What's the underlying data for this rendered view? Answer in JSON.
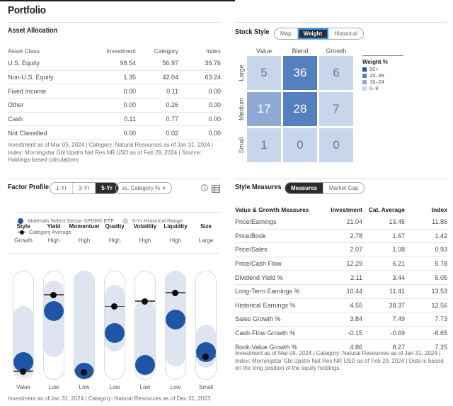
{
  "page": {
    "title": "Portfolio"
  },
  "asset_allocation": {
    "title": "Asset Allocation",
    "columns": [
      "Asset Class",
      "Investment",
      "Category",
      "Index"
    ],
    "rows": [
      [
        "U.S. Equity",
        "98.54",
        "56.97",
        "36.76"
      ],
      [
        "Non-U.S. Equity",
        "1.35",
        "42.04",
        "63.24"
      ],
      [
        "Fixed Income",
        "0.00",
        "0.11",
        "0.00"
      ],
      [
        "Other",
        "0.00",
        "0.26",
        "0.00"
      ],
      [
        "Cash",
        "0.11",
        "0.77",
        "0.00"
      ],
      [
        "Not Classified",
        "0.00",
        "0.02",
        "0.00"
      ]
    ],
    "footnote": "Investment as of Mar 05, 2024 | Category: Natural Resources as of Jan 31, 2024 | Index: Morningstar Gbl Upstm Nat Res NR USD as of Feb 29, 2024 | Source: Holdings-based calculations."
  },
  "stock_style": {
    "title": "Stock Style",
    "tabs": [
      {
        "label": "Map",
        "active": false
      },
      {
        "label": "Weight",
        "active": true
      },
      {
        "label": "Historical",
        "active": false
      }
    ],
    "columns": [
      "Value",
      "Blend",
      "Growth"
    ],
    "rows": [
      "Large",
      "Medium",
      "Small"
    ],
    "cells": [
      [
        5,
        36,
        6
      ],
      [
        17,
        28,
        7
      ],
      [
        1,
        0,
        0
      ]
    ],
    "legend": {
      "title": "Weight %",
      "items": [
        {
          "label": "50+",
          "color": "#1f55a5"
        },
        {
          "label": "25–49",
          "color": "#5580bf"
        },
        {
          "label": "10–24",
          "color": "#8fa9d4"
        },
        {
          "label": "0–9",
          "color": "#c8d6ea"
        }
      ]
    }
  },
  "factor_profile": {
    "title": "Factor Profile",
    "period_tabs": [
      {
        "label": "1-Yr",
        "active": false
      },
      {
        "label": "3-Yr",
        "active": false
      },
      {
        "label": "5-Yr",
        "active": true
      }
    ],
    "compare_dropdown": "vs. Category % ∨",
    "icons": [
      "info-icon",
      "table-icon"
    ],
    "legend": {
      "fund": "Materials Select Sector SPDR® ETF",
      "range": "5-Yr Historical Range",
      "category": "Category Average"
    },
    "colors": {
      "fund": "#1f55a5",
      "range": "#dfe5f0",
      "category": "#0a0a0a"
    },
    "factors": [
      {
        "name": "Style",
        "top": "Growth",
        "bottom": "Value",
        "fund_pct": 15,
        "cat_pct": 6,
        "range_pct": [
          4,
          62
        ]
      },
      {
        "name": "Yield",
        "top": "High",
        "bottom": "Low",
        "fund_pct": 63,
        "cat_pct": 78,
        "range_pct": [
          25,
          86
        ]
      },
      {
        "name": "Momentum",
        "top": "High",
        "bottom": "Low",
        "fund_pct": 5,
        "cat_pct": 5,
        "range_pct": [
          0,
          96
        ]
      },
      {
        "name": "Quality",
        "top": "High",
        "bottom": "Low",
        "fund_pct": 42,
        "cat_pct": 67,
        "range_pct": [
          30,
          82
        ]
      },
      {
        "name": "Volatility",
        "top": "High",
        "bottom": "Low",
        "fund_pct": 12,
        "cat_pct": 72,
        "range_pct": [
          7,
          69
        ]
      },
      {
        "name": "Liquidity",
        "top": "High",
        "bottom": "Low",
        "fund_pct": 55,
        "cat_pct": 80,
        "range_pct": [
          16,
          95
        ]
      },
      {
        "name": "Size",
        "top": "Large",
        "bottom": "Small",
        "fund_pct": 24,
        "cat_pct": 20,
        "range_pct": [
          15,
          45
        ]
      }
    ],
    "footnote": "Investment as of Jan 31, 2024 | Category: Natural Resources as of Dec 31, 2023"
  },
  "style_measures": {
    "title": "Style Measures",
    "tabs": [
      {
        "label": "Measures",
        "active": true
      },
      {
        "label": "Market Cap",
        "active": false
      }
    ],
    "columns": [
      "Value & Growth Measures",
      "Investment",
      "Cat. Average",
      "Index"
    ],
    "rows": [
      [
        "Price/Earnings",
        "21.04",
        "13.45",
        "11.85"
      ],
      [
        "Price/Book",
        "2.78",
        "1.67",
        "1.42"
      ],
      [
        "Price/Sales",
        "2.07",
        "1.08",
        "0.93"
      ],
      [
        "Price/Cash Flow",
        "12.29",
        "6.21",
        "5.78"
      ],
      [
        "Dividend Yield %",
        "2.11",
        "3.44",
        "5.05"
      ],
      [
        "Long-Term Earnings %",
        "10.44",
        "11.41",
        "13.53"
      ],
      [
        "Historical Earnings %",
        "4.55",
        "38.37",
        "12.56"
      ],
      [
        "Sales Growth %",
        "3.84",
        "7.49",
        "7.73"
      ],
      [
        "Cash-Flow Growth %",
        "-0.15",
        "-0.69",
        "-8.65"
      ],
      [
        "Book-Value Growth %",
        "4.86",
        "8.27",
        "7.25"
      ]
    ],
    "footnote": "Investment as of Mar 05, 2024 | Category: Natural Resources as of Jan 31, 2024 | Index: Morningstar Gbl Upstm Nat Res NR USD as of Feb 29, 2024 | Data is based on the long position of the equity holdings."
  }
}
